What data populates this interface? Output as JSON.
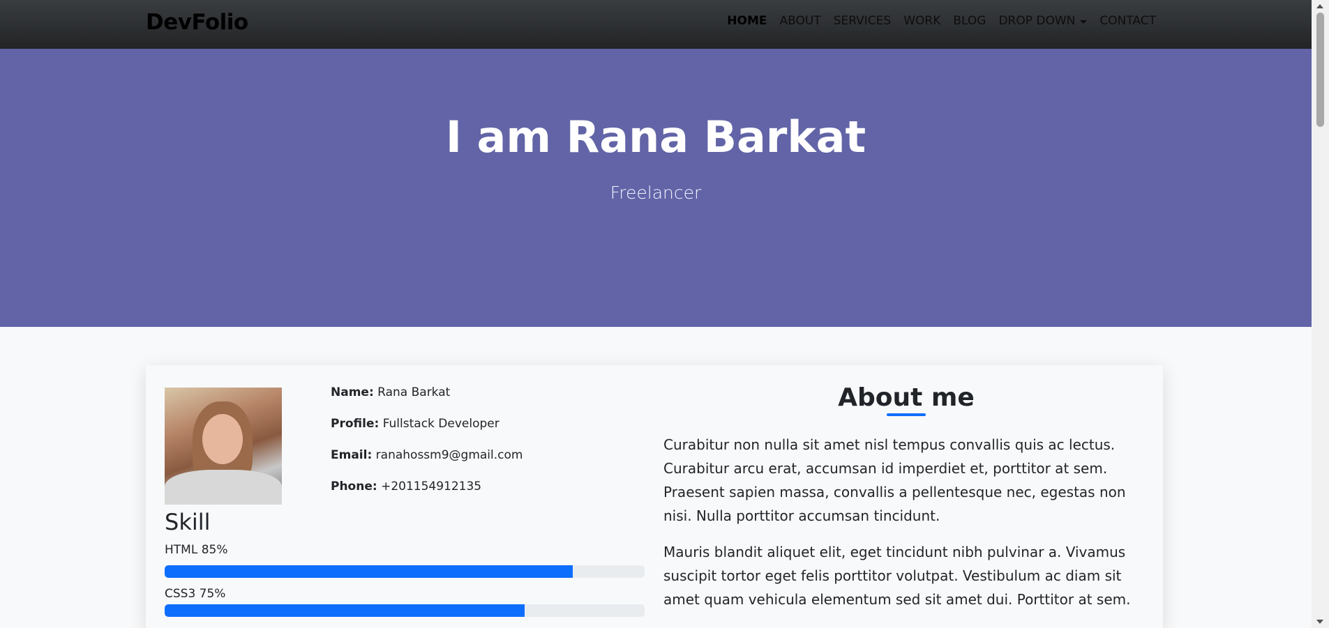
{
  "brand": "DevFolio",
  "nav": {
    "items": [
      "HOME",
      "ABOUT",
      "SERVICES",
      "WORK",
      "BLOG",
      "DROP DOWN",
      "CONTACT"
    ]
  },
  "hero": {
    "title": "I am Rana Barkat",
    "subtitle": "Freelancer"
  },
  "profile": {
    "name_label": "Name:",
    "name": "Rana Barkat",
    "profile_label": "Profile:",
    "profile": "Fullstack Developer",
    "email_label": "Email:",
    "email": "ranahossm9@gmail.com",
    "phone_label": "Phone:",
    "phone": "+201154912135"
  },
  "skills": {
    "title": "Skill",
    "items": [
      {
        "label": "HTML 85%",
        "percent": 85
      },
      {
        "label": "CSS3 75%",
        "percent": 75
      }
    ]
  },
  "about": {
    "title": "About me",
    "paragraphs": [
      "Curabitur non nulla sit amet nisl tempus convallis quis ac lectus. Curabitur arcu erat, accumsan id imperdiet et, porttitor at sem. Praesent sapien massa, convallis a pellentesque nec, egestas non nisi. Nulla porttitor accumsan tincidunt.",
      "Mauris blandit aliquet elit, eget tincidunt nibh pulvinar a. Vivamus suscipit tortor eget felis porttitor volutpat. Vestibulum ac diam sit amet quam vehicula elementum sed sit amet dui. Porttitor at sem."
    ]
  },
  "colors": {
    "hero_bg": "#6264a7",
    "accent": "#0d6efd",
    "navbar": "#2b2d30"
  }
}
